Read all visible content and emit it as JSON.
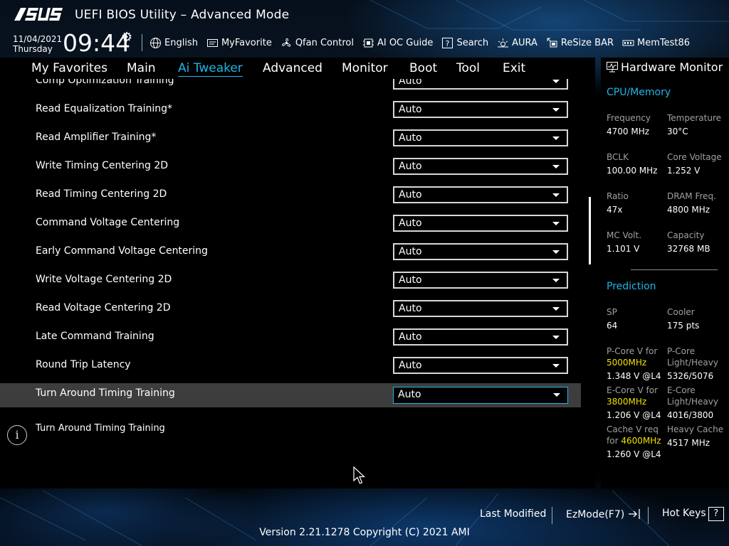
{
  "header": {
    "title": "UEFI BIOS Utility – Advanced Mode",
    "date": "11/04/2021",
    "day": "Thursday",
    "time": "09:44",
    "toolbar": [
      {
        "label": "English",
        "icon": "globe-icon"
      },
      {
        "label": "MyFavorite",
        "icon": "favorite-icon"
      },
      {
        "label": "Qfan Control",
        "icon": "fan-icon"
      },
      {
        "label": "AI OC Guide",
        "icon": "ai-oc-guide-icon"
      },
      {
        "label": "Search",
        "icon": "search-icon"
      },
      {
        "label": "AURA",
        "icon": "aura-icon"
      },
      {
        "label": "ReSize BAR",
        "icon": "resize-bar-icon"
      },
      {
        "label": "MemTest86",
        "icon": "memtest-icon"
      }
    ]
  },
  "nav": {
    "items": [
      "My Favorites",
      "Main",
      "Ai Tweaker",
      "Advanced",
      "Monitor",
      "Boot",
      "Tool",
      "Exit"
    ],
    "active": "Ai Tweaker"
  },
  "settings": [
    {
      "label": "Comp Optimization Training",
      "value": "Auto"
    },
    {
      "label": "Read Equalization Training*",
      "value": "Auto"
    },
    {
      "label": "Read Amplifier Training*",
      "value": "Auto"
    },
    {
      "label": "Write Timing Centering 2D",
      "value": "Auto"
    },
    {
      "label": "Read Timing Centering 2D",
      "value": "Auto"
    },
    {
      "label": "Command Voltage Centering",
      "value": "Auto"
    },
    {
      "label": "Early Command Voltage Centering",
      "value": "Auto"
    },
    {
      "label": "Write Voltage Centering 2D",
      "value": "Auto"
    },
    {
      "label": "Read Voltage Centering 2D",
      "value": "Auto"
    },
    {
      "label": "Late Command Training",
      "value": "Auto"
    },
    {
      "label": "Round Trip Latency",
      "value": "Auto"
    },
    {
      "label": "Turn Around Timing Training",
      "value": "Auto"
    }
  ],
  "selected_setting": "Turn Around Timing Training",
  "help": {
    "text": "Turn Around Timing Training"
  },
  "hardware_monitor": {
    "title": "Hardware Monitor",
    "cpu_memory": {
      "heading": "CPU/Memory",
      "items": [
        {
          "label": "Frequency",
          "value": "4700 MHz"
        },
        {
          "label": "Temperature",
          "value": "30°C"
        },
        {
          "label": "BCLK",
          "value": "100.00 MHz"
        },
        {
          "label": "Core Voltage",
          "value": "1.252 V"
        },
        {
          "label": "Ratio",
          "value": "47x"
        },
        {
          "label": "DRAM Freq.",
          "value": "4800 MHz"
        },
        {
          "label": "MC Volt.",
          "value": "1.101 V"
        },
        {
          "label": "Capacity",
          "value": "32768 MB"
        }
      ]
    },
    "prediction": {
      "heading": "Prediction",
      "sp_label": "SP",
      "sp_value": "64",
      "cooler_label": "Cooler",
      "cooler_value": "175 pts",
      "pcore_v_label": "P-Core V for",
      "pcore_v_freq": "5000MHz",
      "pcore_v_value": "1.348 V @L4",
      "pcore_lh_label1": "P-Core",
      "pcore_lh_label2": "Light/Heavy",
      "pcore_lh_value": "5326/5076",
      "ecore_v_label": "E-Core V for",
      "ecore_v_freq": "3800MHz",
      "ecore_v_value": "1.206 V @L4",
      "ecore_lh_label1": "E-Core",
      "ecore_lh_label2": "Light/Heavy",
      "ecore_lh_value": "4016/3800",
      "cache_v_label1": "Cache V req",
      "cache_v_label2": "for",
      "cache_v_freq": "4600MHz",
      "cache_v_value": "1.260 V @L4",
      "heavy_cache_label": "Heavy Cache",
      "heavy_cache_value": "4517 MHz"
    }
  },
  "footer": {
    "last_modified": "Last Modified",
    "ezmode": "EzMode(F7)",
    "hot_keys": "Hot Keys",
    "hot_keys_symbol": "?",
    "version": "Version 2.21.1278 Copyright (C) 2021 AMI"
  },
  "colors": {
    "accent": "#1fb5e8",
    "highlight": "#f0e000",
    "selected_row": "#3d3d3d"
  }
}
